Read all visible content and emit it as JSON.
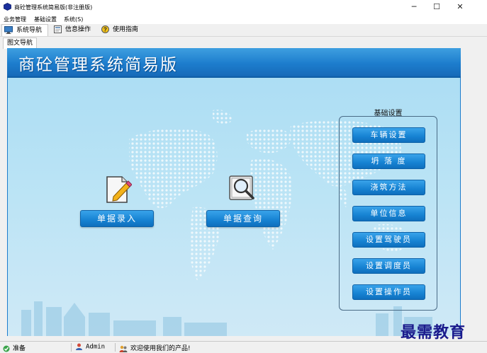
{
  "window": {
    "title": "商砼管理系统简易版(非注册版)",
    "minimize_glyph": "─",
    "maximize_glyph": "☐",
    "close_glyph": "✕"
  },
  "menu": [
    "业务管理",
    "基础设置",
    "系统(S)"
  ],
  "toolbar": [
    {
      "label": "系统导航",
      "icon": "monitor-icon",
      "active": true
    },
    {
      "label": "信息操作",
      "icon": "form-icon",
      "active": false
    },
    {
      "label": "使用指南",
      "icon": "help-icon",
      "active": false
    }
  ],
  "tab": {
    "label": "图文导航"
  },
  "main": {
    "title": "商砼管理系统简易版",
    "entry_button": "单据录入",
    "query_button": "单据查询",
    "entry_icon": "edit-document-icon",
    "query_icon": "magnifier-icon"
  },
  "settings": {
    "title": "基础设置",
    "buttons": [
      "车辆设置",
      "坍 落 度",
      "浇筑方法",
      "单位信息",
      "设置驾驶员",
      "设置调度员",
      "设置操作员"
    ]
  },
  "status": {
    "ready": "准备",
    "user": "Admin",
    "message": "欢迎使用我们的产品!"
  },
  "watermark": "最需教育",
  "colors": {
    "header": "#1d7dcd",
    "button": "#1682d2",
    "background": "#b9e3f5"
  }
}
